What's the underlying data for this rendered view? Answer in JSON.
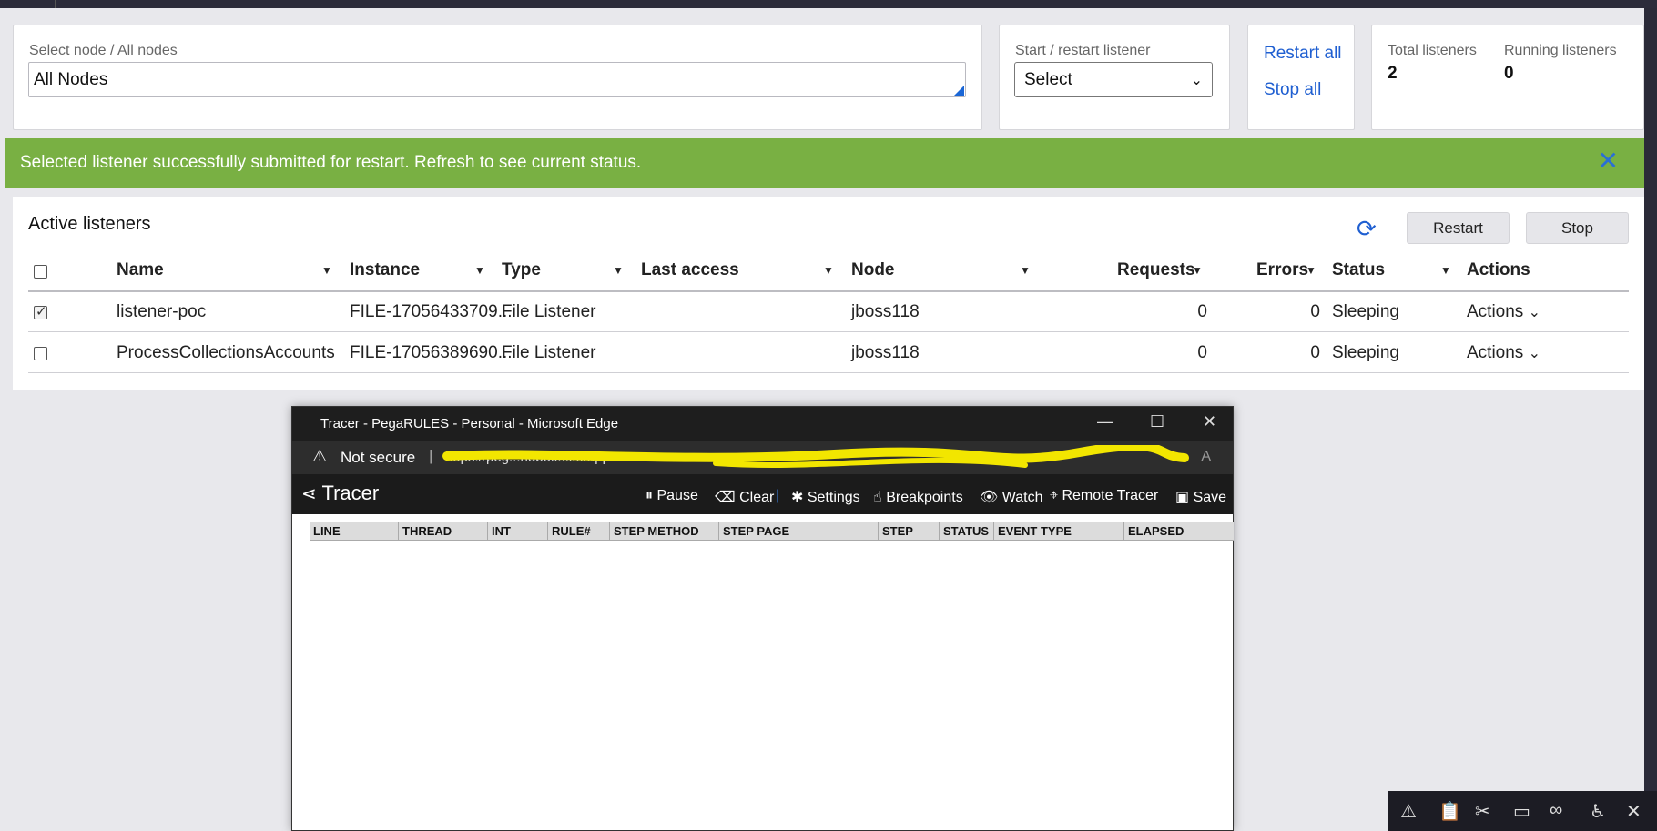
{
  "filters": {
    "node_label": "Select node / All nodes",
    "node_value": "All Nodes",
    "listener_label": "Start / restart listener",
    "listener_value": "Select",
    "restart_all": "Restart all",
    "stop_all": "Stop all"
  },
  "summary": {
    "total_label": "Total listeners",
    "total_value": "2",
    "running_label": "Running listeners",
    "running_value": "0"
  },
  "banner": {
    "message": "Selected listener successfully submitted for restart. Refresh to see current status.",
    "close_glyph": "✕"
  },
  "listeners": {
    "title": "Active listeners",
    "restart_label": "Restart",
    "stop_label": "Stop",
    "refresh_glyph": "⟳",
    "columns": {
      "name": "Name",
      "instance": "Instance",
      "type": "Type",
      "last_access": "Last access",
      "node": "Node",
      "requests": "Requests",
      "errors": "Errors",
      "status": "Status",
      "actions": "Actions"
    },
    "rows": [
      {
        "checked": true,
        "name": "listener-poc",
        "instance": "FILE-17056433709...",
        "type": "File Listener",
        "last_access": "",
        "node": "jboss118",
        "requests": "0",
        "errors": "0",
        "status": "Sleeping",
        "actions": "Actions"
      },
      {
        "checked": false,
        "name": "ProcessCollectionsAccounts",
        "instance": "FILE-17056389690...",
        "type": "File Listener",
        "last_access": "",
        "node": "jboss118",
        "requests": "0",
        "errors": "0",
        "status": "Sleeping",
        "actions": "Actions"
      }
    ]
  },
  "tracer": {
    "window_title": "Tracer - PegaRULES - Personal - Microsoft Edge",
    "not_secure": "Not secure",
    "url_partial": "https://peg...ndbox...i.../app...",
    "brand": "Tracer",
    "toolbar": {
      "pause": "Pause",
      "clear": "Clear",
      "settings": "Settings",
      "breakpoints": "Breakpoints",
      "watch": "Watch",
      "remote_tracer": "Remote Tracer",
      "save": "Save"
    },
    "grid_columns": [
      "LINE",
      "THREAD",
      "INT",
      "RULE#",
      "STEP METHOD",
      "STEP PAGE",
      "STEP",
      "STATUS",
      "EVENT TYPE",
      "ELAPSED"
    ]
  },
  "dock_icons": [
    "warning-icon",
    "clipboard-icon",
    "scissors-icon",
    "cast-icon",
    "glasses-icon",
    "accessibility-icon",
    "close-icon"
  ]
}
